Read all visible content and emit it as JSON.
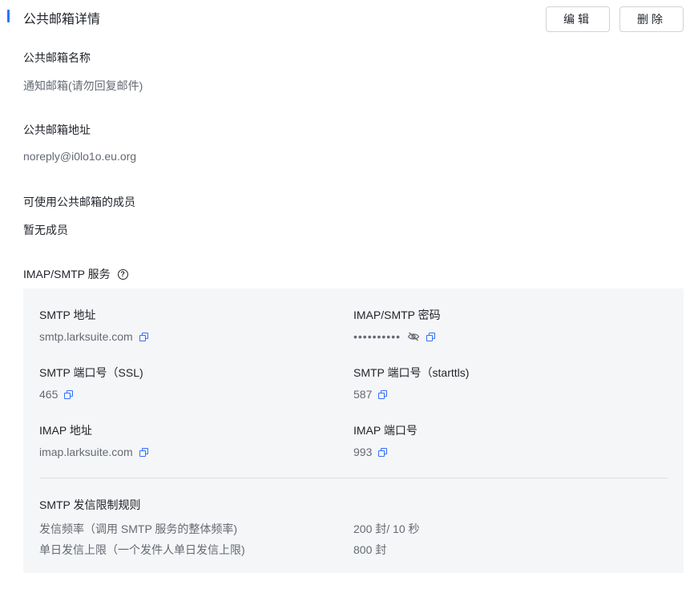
{
  "page": {
    "title": "公共邮箱详情",
    "edit_label": "编辑",
    "delete_label": "删除"
  },
  "fields": {
    "name_label": "公共邮箱名称",
    "name_value": "通知邮箱(请勿回复邮件)",
    "address_label": "公共邮箱地址",
    "address_value": "noreply@i0lo1o.eu.org",
    "members_label": "可使用公共邮箱的成员",
    "members_value": "暂无成员"
  },
  "service": {
    "title": "IMAP/SMTP 服务",
    "help_icon": "?",
    "smtp_address_label": "SMTP 地址",
    "smtp_address_value": "smtp.larksuite.com",
    "password_label": "IMAP/SMTP 密码",
    "password_value": "••••••••••",
    "smtp_ssl_port_label": "SMTP 端口号（SSL)",
    "smtp_ssl_port_value": "465",
    "smtp_starttls_port_label": "SMTP 端口号（starttls)",
    "smtp_starttls_port_value": "587",
    "imap_address_label": "IMAP 地址",
    "imap_address_value": "imap.larksuite.com",
    "imap_port_label": "IMAP 端口号",
    "imap_port_value": "993",
    "limits_title": "SMTP 发信限制规则",
    "rate_label": "发信频率（调用 SMTP 服务的整体频率)",
    "rate_value": "200 封/ 10 秒",
    "daily_label": "单日发信上限（一个发件人单日发信上限)",
    "daily_value": "800 封"
  },
  "colors": {
    "accent": "#3370ff",
    "panel_bg": "#f5f6f7",
    "text_primary": "#1f2329",
    "text_secondary": "#646a73"
  },
  "icons": {
    "copy": "copy-icon",
    "eye_off": "eye-off-icon",
    "help": "question-circle-icon"
  }
}
